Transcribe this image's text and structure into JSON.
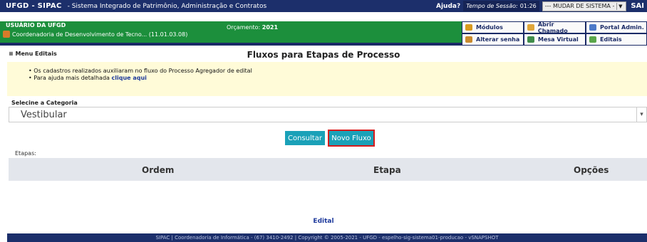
{
  "header": {
    "brand": "UFGD - SIPAC",
    "system_name": "- Sistema Integrado de Patrimônio, Administração e Contratos",
    "ajuda": "Ajuda?",
    "session_label": "Tempo de Sessão:",
    "session_time": "01:26",
    "change_system": "--- MUDAR DE SISTEMA -",
    "sair": "SAI"
  },
  "userbar": {
    "user": "USUÁRIO DA UFGD",
    "unit": "Coordenadoria de Desenvolvimento de Tecno... (11.01.03.08)",
    "budget_label": "Orçamento:",
    "budget_year": "2021"
  },
  "menu": {
    "items": [
      {
        "label": "Módulos",
        "icon": "modules-icon",
        "color": "#d89a1e"
      },
      {
        "label": "Abrir Chamado",
        "icon": "ticket-icon",
        "color": "#e0a63a"
      },
      {
        "label": "Portal Admin.",
        "icon": "portal-icon",
        "color": "#4d7ac9"
      },
      {
        "label": "Alterar senha",
        "icon": "key-icon",
        "color": "#c98a2e"
      },
      {
        "label": "Mesa Virtual",
        "icon": "desk-icon",
        "color": "#3f8c4a"
      },
      {
        "label": "Editais",
        "icon": "editais-icon",
        "color": "#5aa64a"
      }
    ]
  },
  "page": {
    "menu_edits": "≡ Menu Editais",
    "title": "Fluxos para Etapas de Processo",
    "info_line1": "• Os cadastros realizados auxiliaram no fluxo do Processo Agregador de edital",
    "info_line2_prefix": "• Para ajuda mais detalhada",
    "info_line2_link": "clique aqui"
  },
  "form": {
    "category_label": "Selecine a Categoria",
    "category_value": "Vestibular",
    "consultar": "Consultar",
    "novo_fluxo": "Novo Fluxo"
  },
  "table": {
    "caption": "Etapas:",
    "columns": [
      "Ordem",
      "Etapa",
      "Opções"
    ]
  },
  "footer": {
    "edital_link": "Edital",
    "text": "SIPAC | Coordenadoria de Informática - (67) 3410-2492 | Copyright © 2005-2021 - UFGD - espelho-sig-sistema01-producao - vSNAPSHOT"
  }
}
